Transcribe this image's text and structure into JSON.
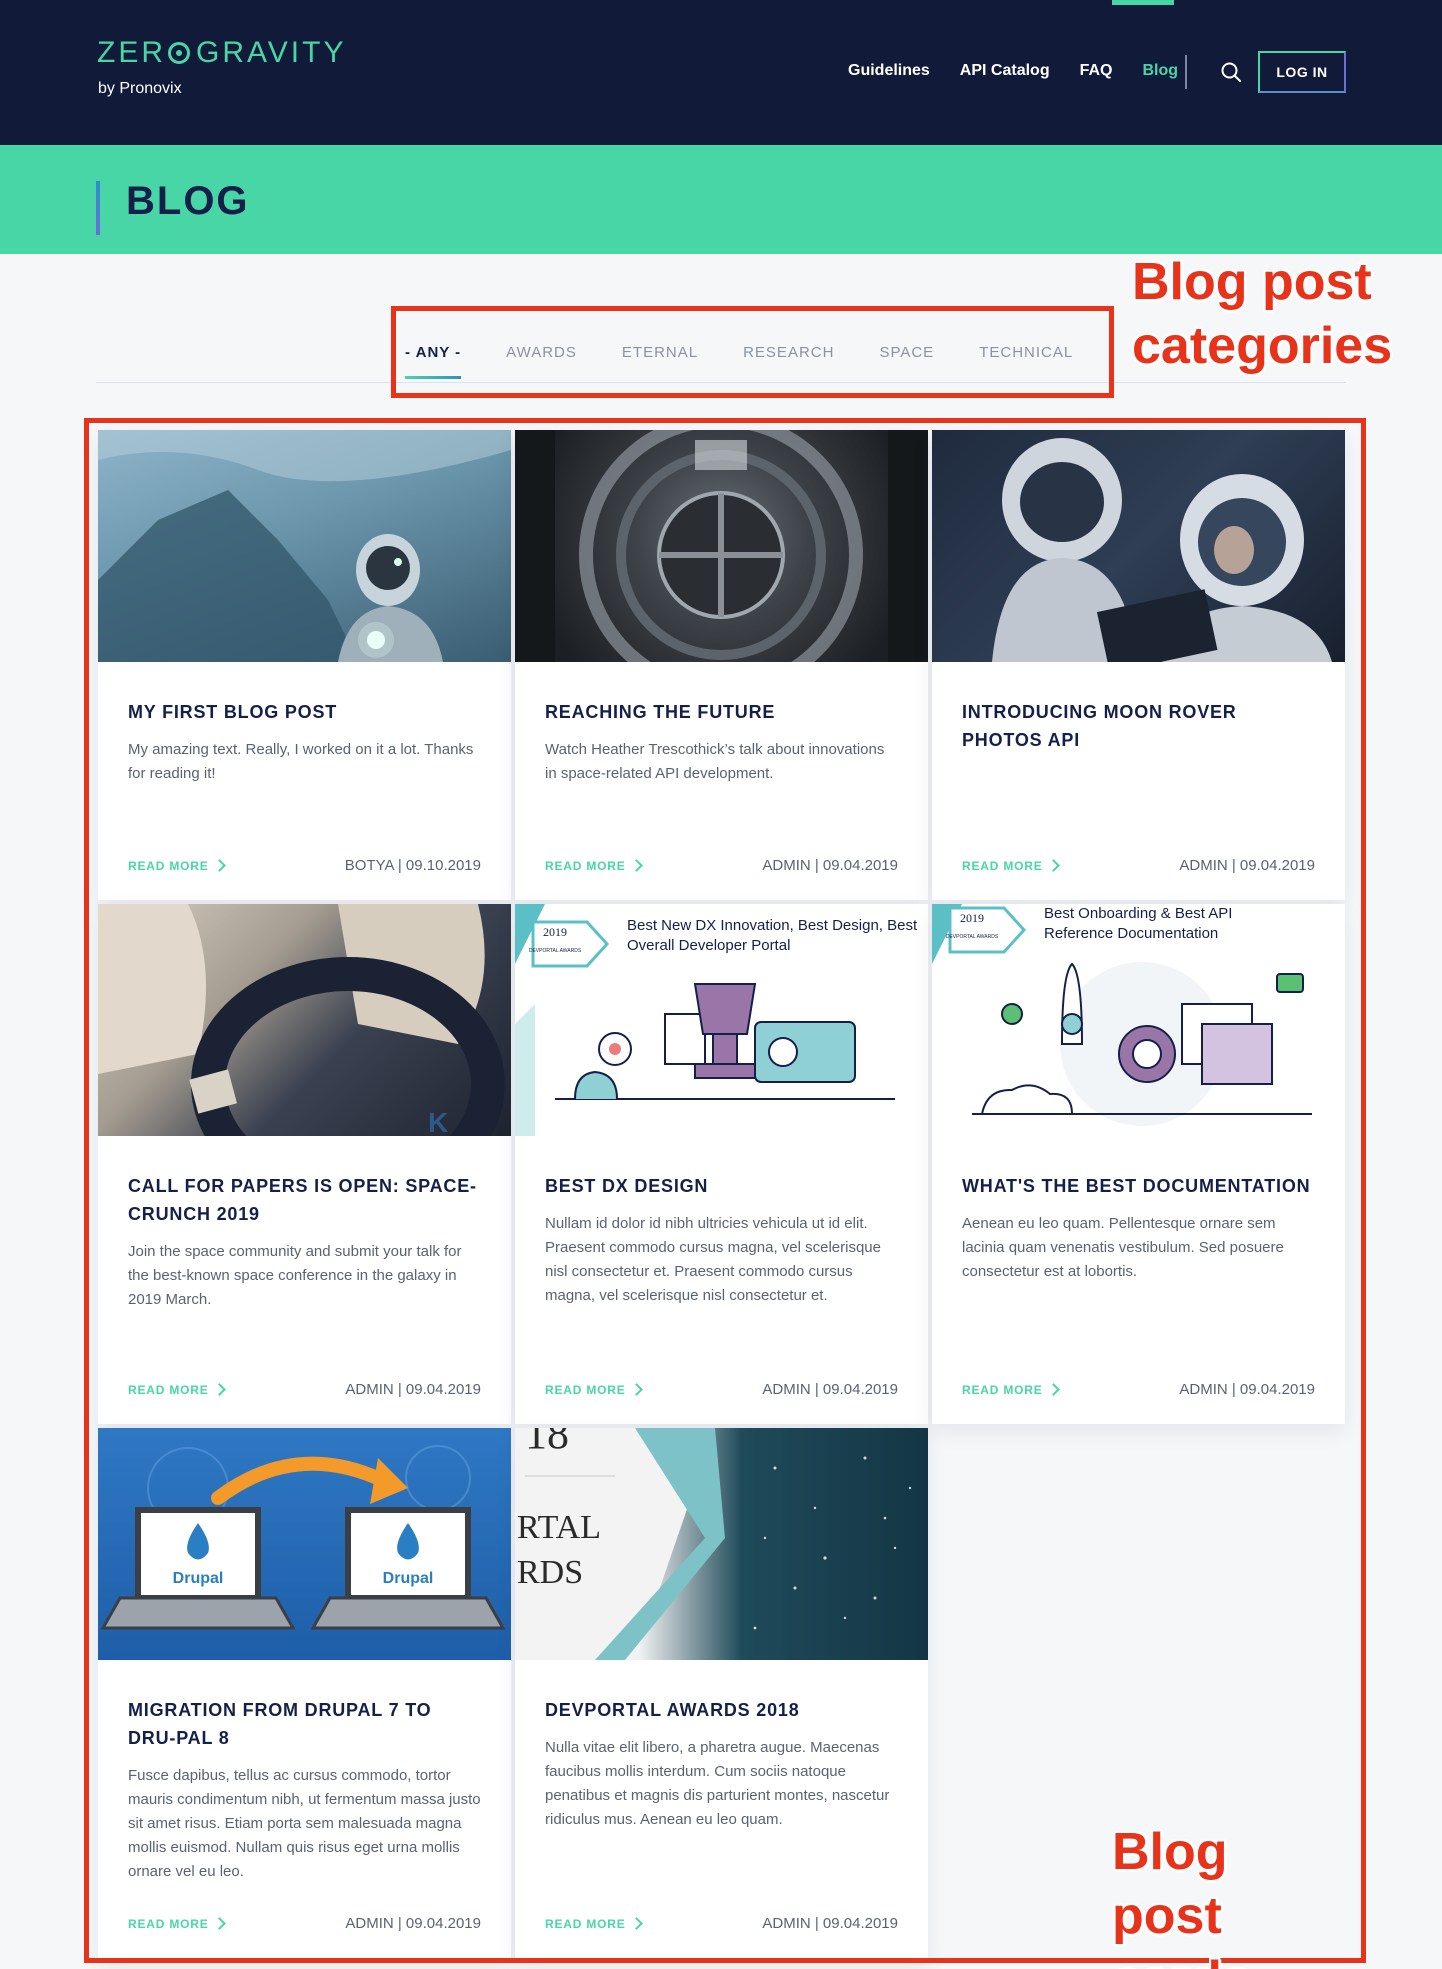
{
  "header": {
    "logo_main": "ZER",
    "logo_tail": "GRAVITY",
    "logo_sub": "by Pronovix",
    "nav": [
      "Guidelines",
      "API Catalog",
      "FAQ",
      "Blog"
    ],
    "active_nav": "Blog",
    "login_label": "LOG IN"
  },
  "banner": {
    "title": "BLOG"
  },
  "filters": {
    "tabs": [
      "- ANY -",
      "AWARDS",
      "ETERNAL",
      "RESEARCH",
      "SPACE",
      "TECHNICAL"
    ],
    "active": "- ANY -"
  },
  "annotations": {
    "categories": "Blog post categories",
    "cards": "Blog post cards"
  },
  "cards": [
    {
      "title": "MY FIRST BLOG POST",
      "text": "My amazing text. Really, I worked on it a lot. Thanks for reading it!",
      "read_more": "READ MORE",
      "meta": "BOTYA | 09.10.2019"
    },
    {
      "title": "REACHING THE FUTURE",
      "text": "Watch Heather Trescothick’s talk about innovations in space-related API development.",
      "read_more": "READ MORE",
      "meta": "ADMIN | 09.04.2019"
    },
    {
      "title": "INTRODUCING MOON ROVER PHOTOS API",
      "text": "",
      "read_more": "READ MORE",
      "meta": "ADMIN | 09.04.2019"
    },
    {
      "title": "CALL FOR PAPERS IS OPEN: SPACE-CRUNCH 2019",
      "text": "Join the space community and submit your talk for the best-known space conference in the galaxy in 2019 March.",
      "read_more": "READ MORE",
      "meta": "ADMIN | 09.04.2019"
    },
    {
      "title": "BEST DX DESIGN",
      "text": "Nullam id dolor id nibh ultricies vehicula ut id elit. Praesent commodo cursus magna, vel scelerisque nisl consectetur et. Praesent commodo cursus magna, vel scelerisque nisl consectetur et.",
      "read_more": "READ MORE",
      "meta": "ADMIN | 09.04.2019",
      "img_year": "2019",
      "img_badge": "DEVPORTAL AWARDS",
      "img_caption": "Best New DX Innovation, Best Design, Best Overall Developer Portal"
    },
    {
      "title": "WHAT'S THE BEST DOCUMENTATION",
      "text": "Aenean eu leo quam. Pellentesque ornare sem lacinia quam venenatis vestibulum. Sed posuere consectetur est at lobortis.",
      "read_more": "READ MORE",
      "meta": "ADMIN | 09.04.2019",
      "img_year": "2019",
      "img_badge": "DEVPORTAL AWARDS",
      "img_caption": "Best Onboarding & Best API Reference Documentation"
    },
    {
      "title": "MIGRATION FROM DRUPAL 7 TO DRU-PAL 8",
      "text": "Fusce dapibus, tellus ac cursus commodo, tortor mauris condimentum nibh, ut fermentum massa justo sit amet risus. Etiam porta sem malesuada magna mollis euismod. Nullam quis risus eget urna mollis ornare vel eu leo.",
      "read_more": "READ MORE",
      "meta": "ADMIN | 09.04.2019",
      "img_brand": "Drupal"
    },
    {
      "title": "DEVPORTAL AWARDS 2018",
      "text": "Nulla vitae elit libero, a pharetra augue. Maecenas faucibus mollis interdum. Cum sociis natoque penatibus et magnis dis parturient montes, nascetur ridiculus mus. Aenean eu leo quam.",
      "read_more": "READ MORE",
      "meta": "ADMIN | 09.04.2019",
      "img_frag1": "RTAL",
      "img_frag2": "RDS"
    }
  ]
}
